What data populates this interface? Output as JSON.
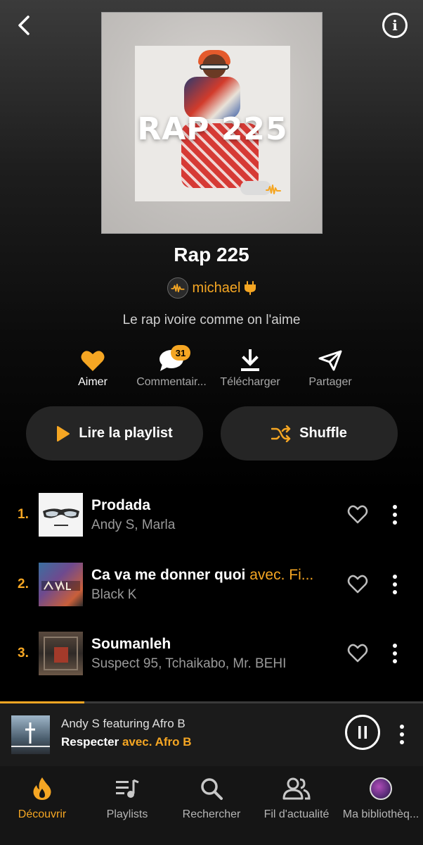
{
  "header": {
    "back_icon": "chevron-left-icon",
    "info_icon": "info-circle-icon"
  },
  "cover": {
    "title": "RAP 225"
  },
  "playlist": {
    "title": "Rap 225",
    "owner": "michael",
    "description": "Le rap ivoire comme on l'aime"
  },
  "actions": {
    "like_label": "Aimer",
    "comments_label": "Commentair...",
    "comments_count": "31",
    "download_label": "Télécharger",
    "share_label": "Partager"
  },
  "buttons": {
    "play_label": "Lire la playlist",
    "shuffle_label": "Shuffle"
  },
  "tracks": [
    {
      "num": "1.",
      "title": "Prodada",
      "feat": "",
      "artists": "Andy S, Marla"
    },
    {
      "num": "2.",
      "title": "Ca va me donner quoi ",
      "feat": "avec. Fi...",
      "artists": "Black K"
    },
    {
      "num": "3.",
      "title": "Soumanleh",
      "feat": "",
      "artists": "Suspect 95, Tchaikabo, Mr. BEHI"
    }
  ],
  "now_playing": {
    "artist_line": "Andy S featuring Afro B",
    "title": "Respecter",
    "feat": " avec. Afro B",
    "progress": 0.2
  },
  "tabs": [
    {
      "label": "Découvrir",
      "icon": "fire-icon"
    },
    {
      "label": "Playlists",
      "icon": "playlist-icon"
    },
    {
      "label": "Rechercher",
      "icon": "search-icon"
    },
    {
      "label": "Fil d'actualité",
      "icon": "people-icon"
    },
    {
      "label": "Ma bibliothèq...",
      "icon": "avatar-icon"
    }
  ],
  "colors": {
    "accent": "#f5a623",
    "background": "#000000",
    "pill": "#252525"
  }
}
